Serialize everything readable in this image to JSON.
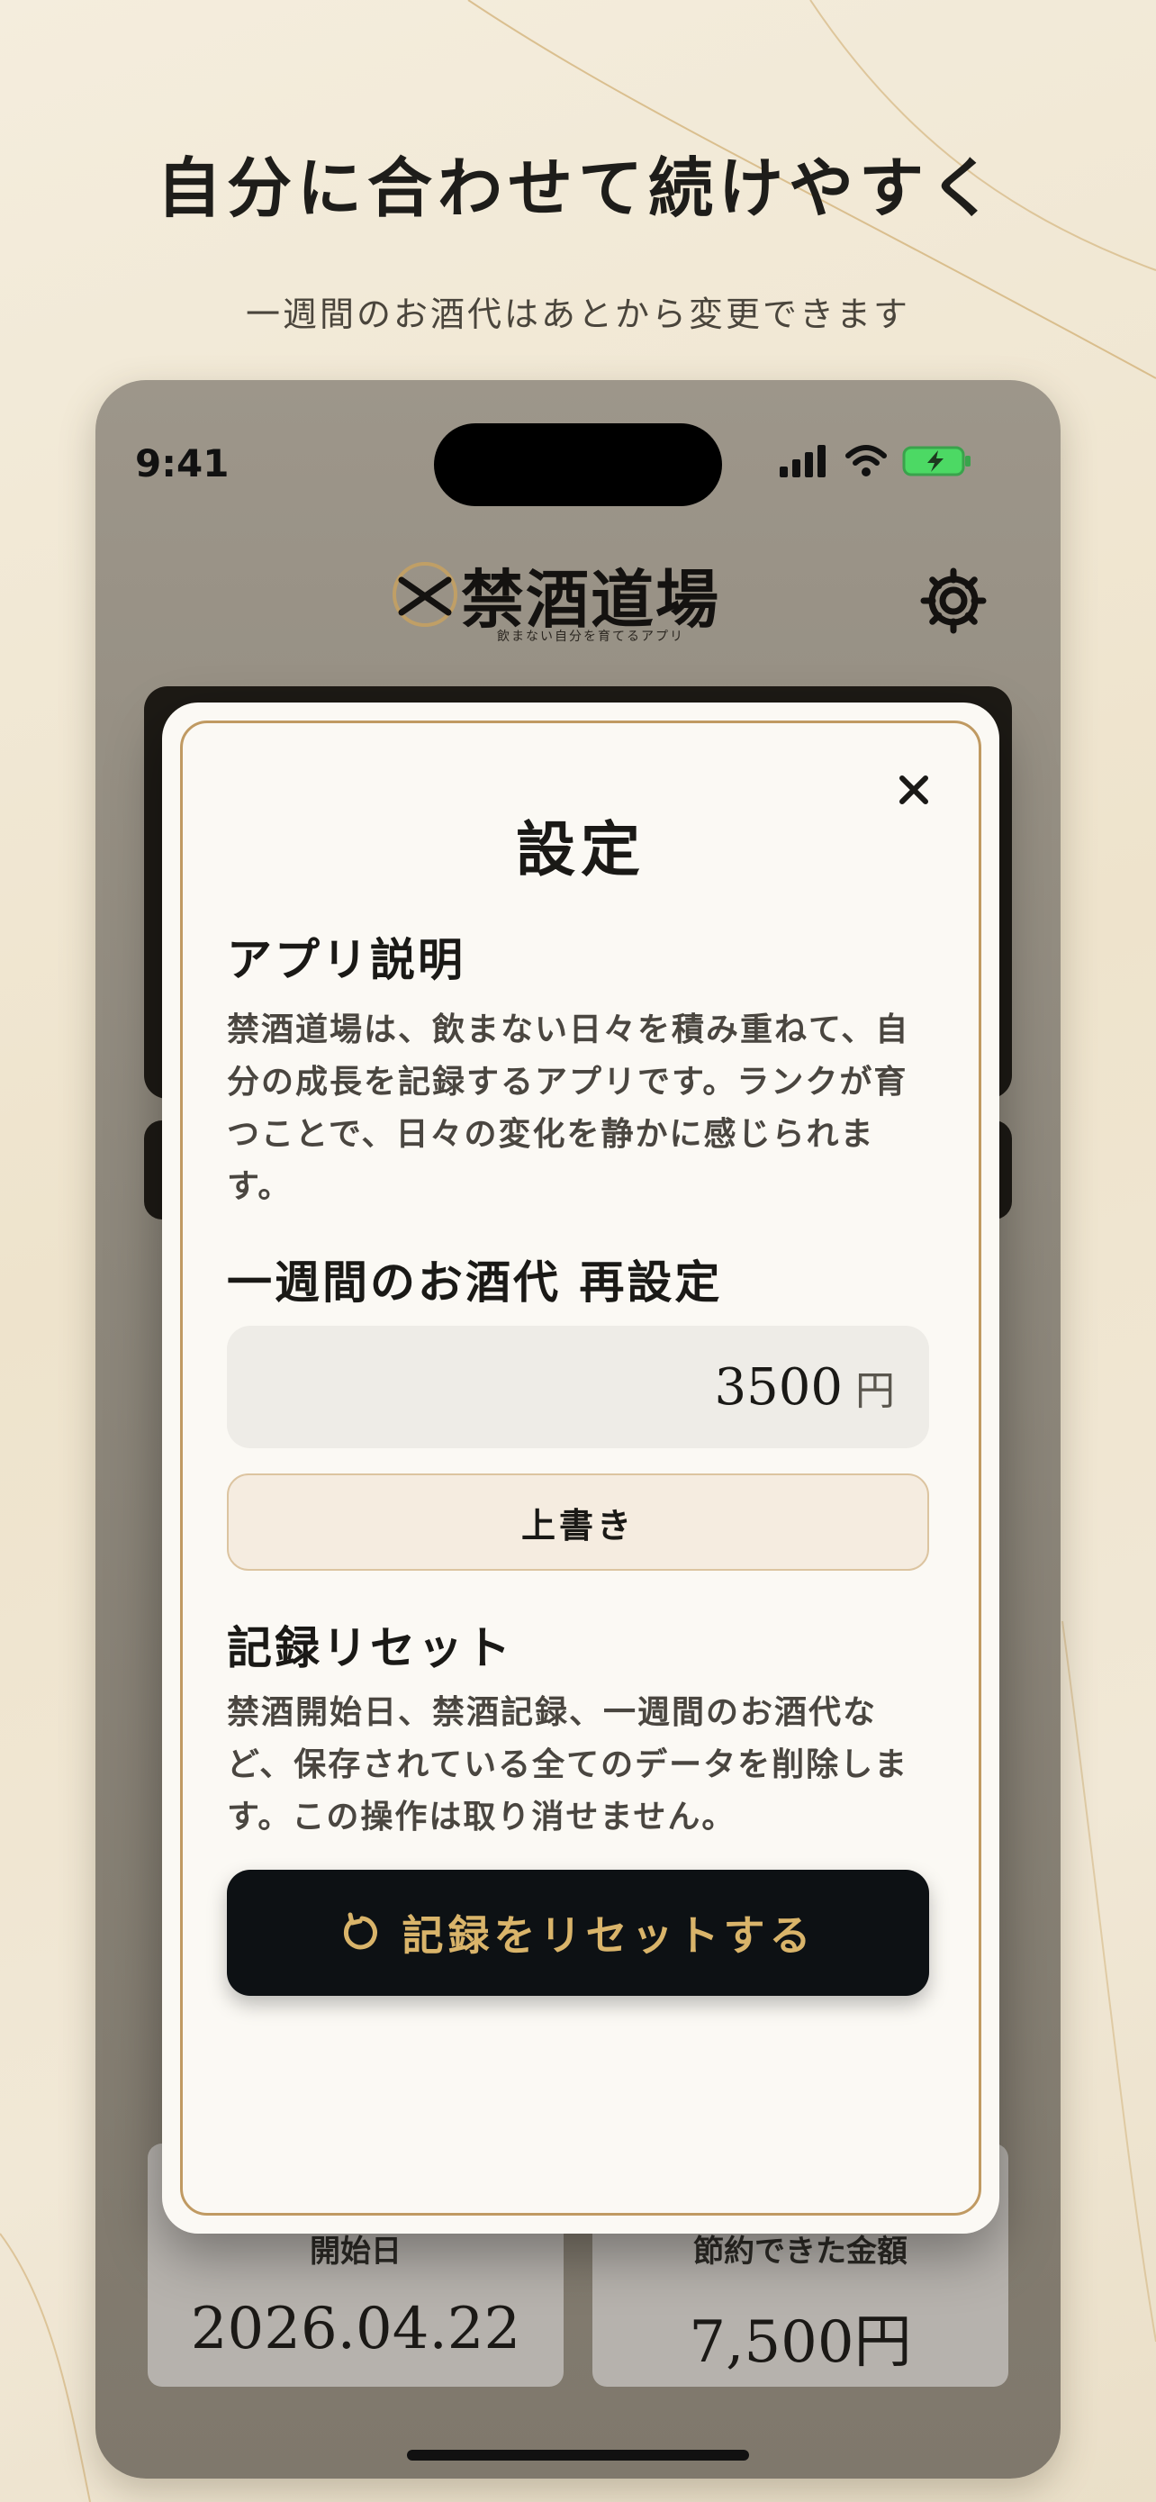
{
  "promo": {
    "headline": "自分に合わせて続けやすく",
    "subline": "一週間のお酒代はあとから変更できます"
  },
  "status_bar": {
    "time": "9:41",
    "icons": [
      "signal-icon",
      "wifi-icon",
      "battery-charging-icon"
    ]
  },
  "app": {
    "logo_title": "禁酒道場",
    "logo_tagline": "飲まない自分を育てるアプリ",
    "accent_color": "#d9b46a",
    "dark_color": "#0d1114"
  },
  "settings_modal": {
    "title": "設定",
    "close_icon": "close-icon",
    "about": {
      "heading": "アプリ説明",
      "text": "禁酒道場は、飲まない日々を積み重ねて、自分の成長を記録するアプリです。ランクが育つことで、日々の変化を静かに感じられます。"
    },
    "weekly_cost": {
      "heading": "一週間のお酒代 再設定",
      "value": "3500",
      "unit": "円",
      "overwrite_label": "上書き"
    },
    "reset": {
      "heading": "記録リセット",
      "text": "禁酒開始日、禁酒記録、一週間のお酒代など、保存されている全てのデータを削除します。この操作は取り消せません。",
      "button_label": "記録をリセットする",
      "button_icon": "reset-icon"
    }
  },
  "stats": {
    "start_label": "開始日",
    "start_value": "2026.04.22",
    "saved_label": "節約できた金額",
    "saved_value": "7,500円"
  }
}
